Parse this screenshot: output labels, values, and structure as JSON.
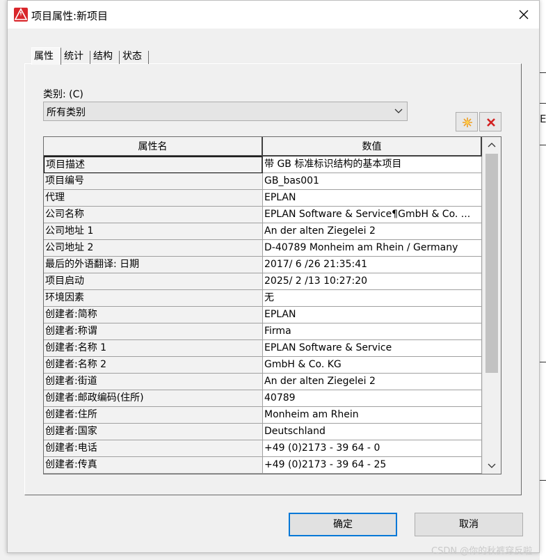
{
  "window": {
    "title": "项目属性:新项目"
  },
  "tabs": [
    {
      "label": "属性",
      "active": true
    },
    {
      "label": "统计",
      "active": false
    },
    {
      "label": "结构",
      "active": false
    },
    {
      "label": "状态",
      "active": false
    }
  ],
  "category": {
    "label": "类别: (C)",
    "selected": "所有类别"
  },
  "table": {
    "columns": [
      "属性名",
      "数值"
    ],
    "rows": [
      [
        "项目描述",
        "带 GB 标准标识结构的基本项目"
      ],
      [
        "项目编号",
        "GB_bas001"
      ],
      [
        "代理",
        "EPLAN"
      ],
      [
        "公司名称",
        "EPLAN Software & Service¶GmbH & Co. ..."
      ],
      [
        "公司地址 1",
        "An der alten Ziegelei 2"
      ],
      [
        "公司地址 2",
        "D-40789 Monheim am Rhein / Germany"
      ],
      [
        "最后的外语翻译: 日期",
        "2017/ 6 /26 21:35:41"
      ],
      [
        "项目启动",
        "2025/ 2 /13 10:27:20"
      ],
      [
        "环境因素",
        "无"
      ],
      [
        "创建者:简称",
        "EPLAN"
      ],
      [
        "创建者:称谓",
        "Firma"
      ],
      [
        "创建者:名称 1",
        "EPLAN Software & Service"
      ],
      [
        "创建者:名称 2",
        "GmbH & Co. KG"
      ],
      [
        "创建者:街道",
        "An der alten Ziegelei 2"
      ],
      [
        "创建者:邮政编码(住所)",
        "40789"
      ],
      [
        "创建者:住所",
        "Monheim am Rhein"
      ],
      [
        "创建者:国家",
        "Deutschland"
      ],
      [
        "创建者:电话",
        "+49 (0)2173 - 39 64 - 0"
      ],
      [
        "创建者:传真",
        "+49 (0)2173 - 39 64 - 25"
      ]
    ]
  },
  "toolbar": {
    "new_icon": "new-star-icon",
    "delete_icon": "delete-x-icon"
  },
  "buttons": {
    "ok": "确定",
    "cancel": "取消"
  },
  "watermark": "CSDN @你的秋裤穿反啦",
  "background_app_char": "EA",
  "colors": {
    "accent": "#0078d7",
    "app_icon": "#d9262b",
    "delete": "#d32020",
    "star": "#f0a020"
  }
}
